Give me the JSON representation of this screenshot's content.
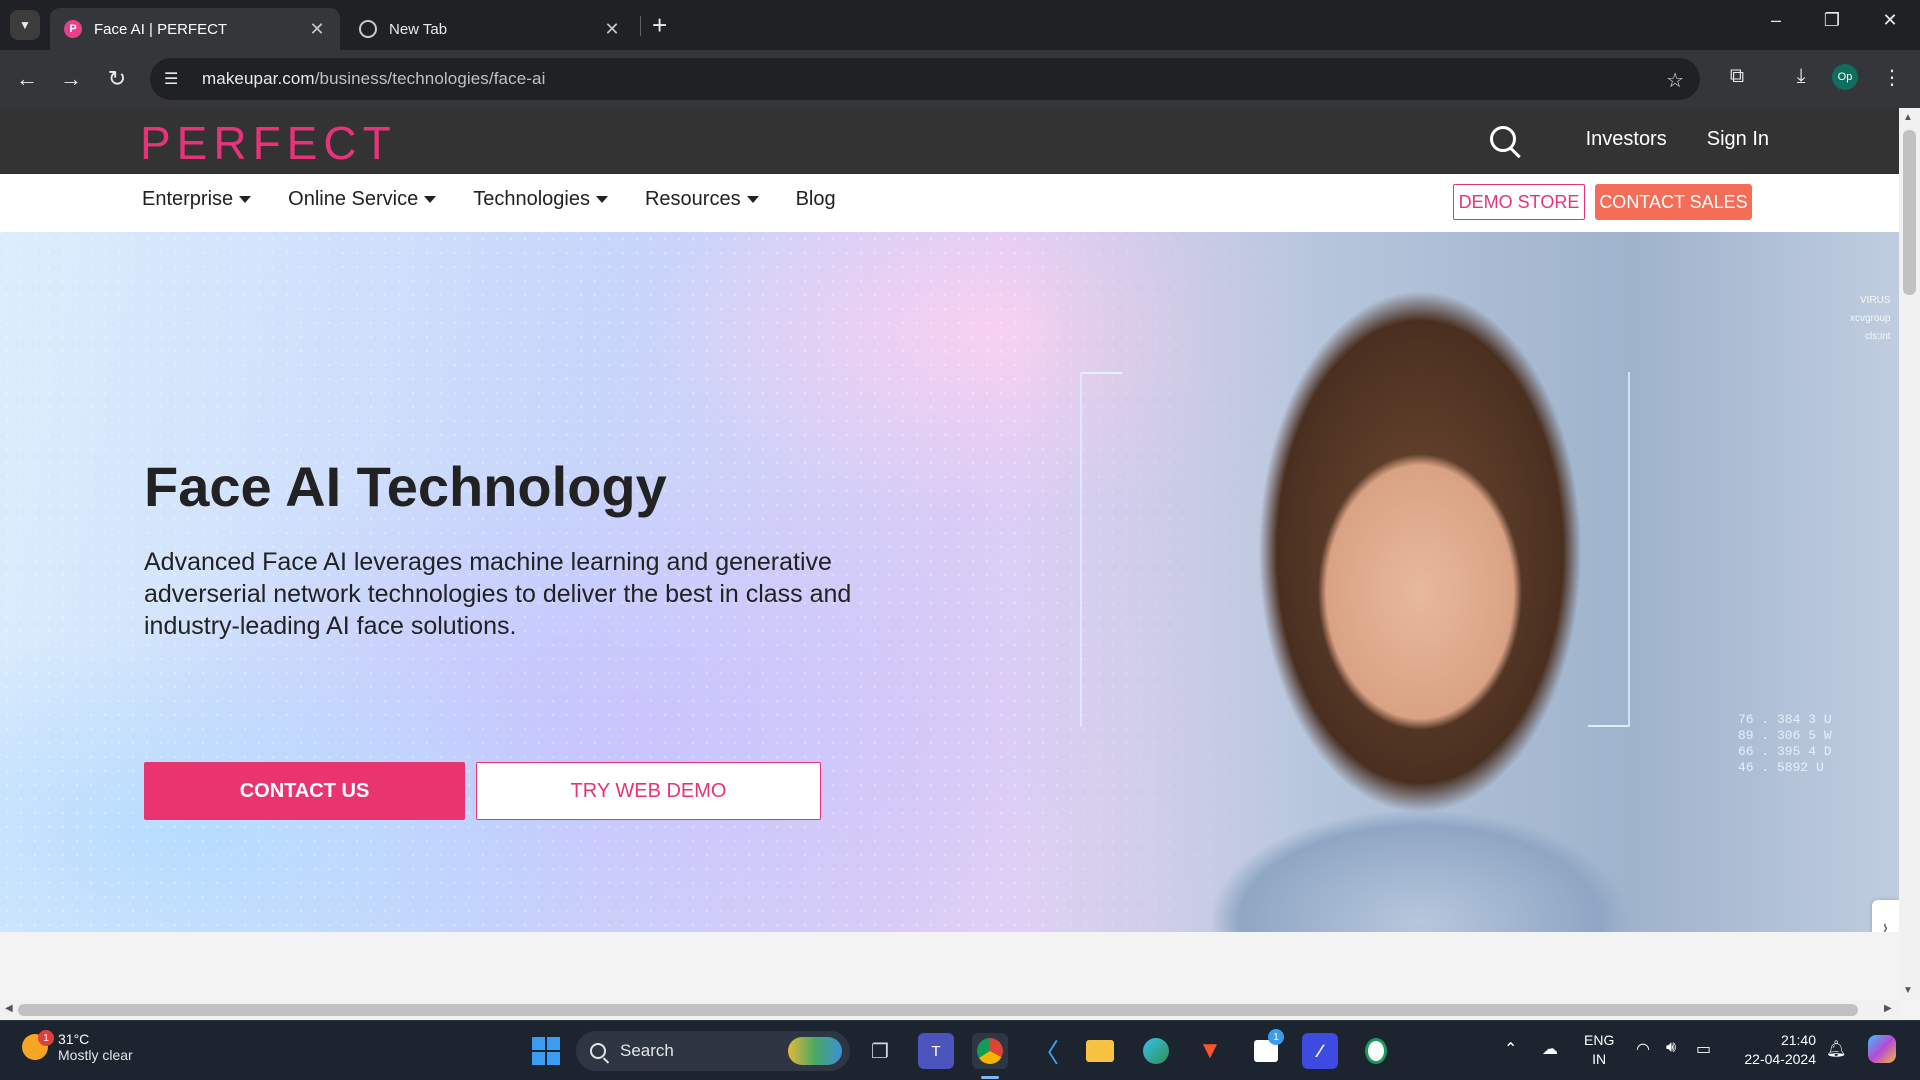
{
  "browser": {
    "tabs": [
      {
        "title": "Face AI | PERFECT",
        "favicon": "P",
        "active": true
      },
      {
        "title": "New Tab",
        "active": false
      }
    ],
    "new_tab_label": "+",
    "url_host": "makeupar.com",
    "url_path": "/business/technologies/face-ai",
    "profile_initials": "Op"
  },
  "site": {
    "brand": "PERFECT",
    "top_links": {
      "investors": "Investors",
      "sign_in": "Sign In"
    },
    "nav": {
      "items": [
        "Enterprise",
        "Online Service",
        "Technologies",
        "Resources",
        "Blog"
      ]
    },
    "demo_store": "DEMO STORE",
    "contact_sales": "CONTACT SALES",
    "colors": {
      "brand_pink": "#e7337a",
      "cta_orange": "#f46d57",
      "cta_pink": "#e8356f"
    }
  },
  "hero": {
    "title": "Face AI Technology",
    "subtitle": "Advanced Face AI leverages machine learning and generative adverserial network technologies to deliver the best in class and industry-leading AI face solutions.",
    "primary_cta": "CONTACT US",
    "secondary_cta": "TRY WEB DEMO",
    "readout": [
      "76 . 384 3 U",
      "89 . 306 5 W",
      "66 . 395 4 D",
      "46 . 5892 U"
    ],
    "readout_top": [
      "VIRUS",
      "xcvgroup",
      "cls;int"
    ]
  },
  "taskbar": {
    "weather_temp": "31°C",
    "weather_cond": "Mostly clear",
    "weather_badge": "1",
    "search_placeholder": "Search",
    "store_badge": "1",
    "lang_line1": "ENG",
    "lang_line2": "IN",
    "time": "21:40",
    "date": "22-04-2024"
  }
}
